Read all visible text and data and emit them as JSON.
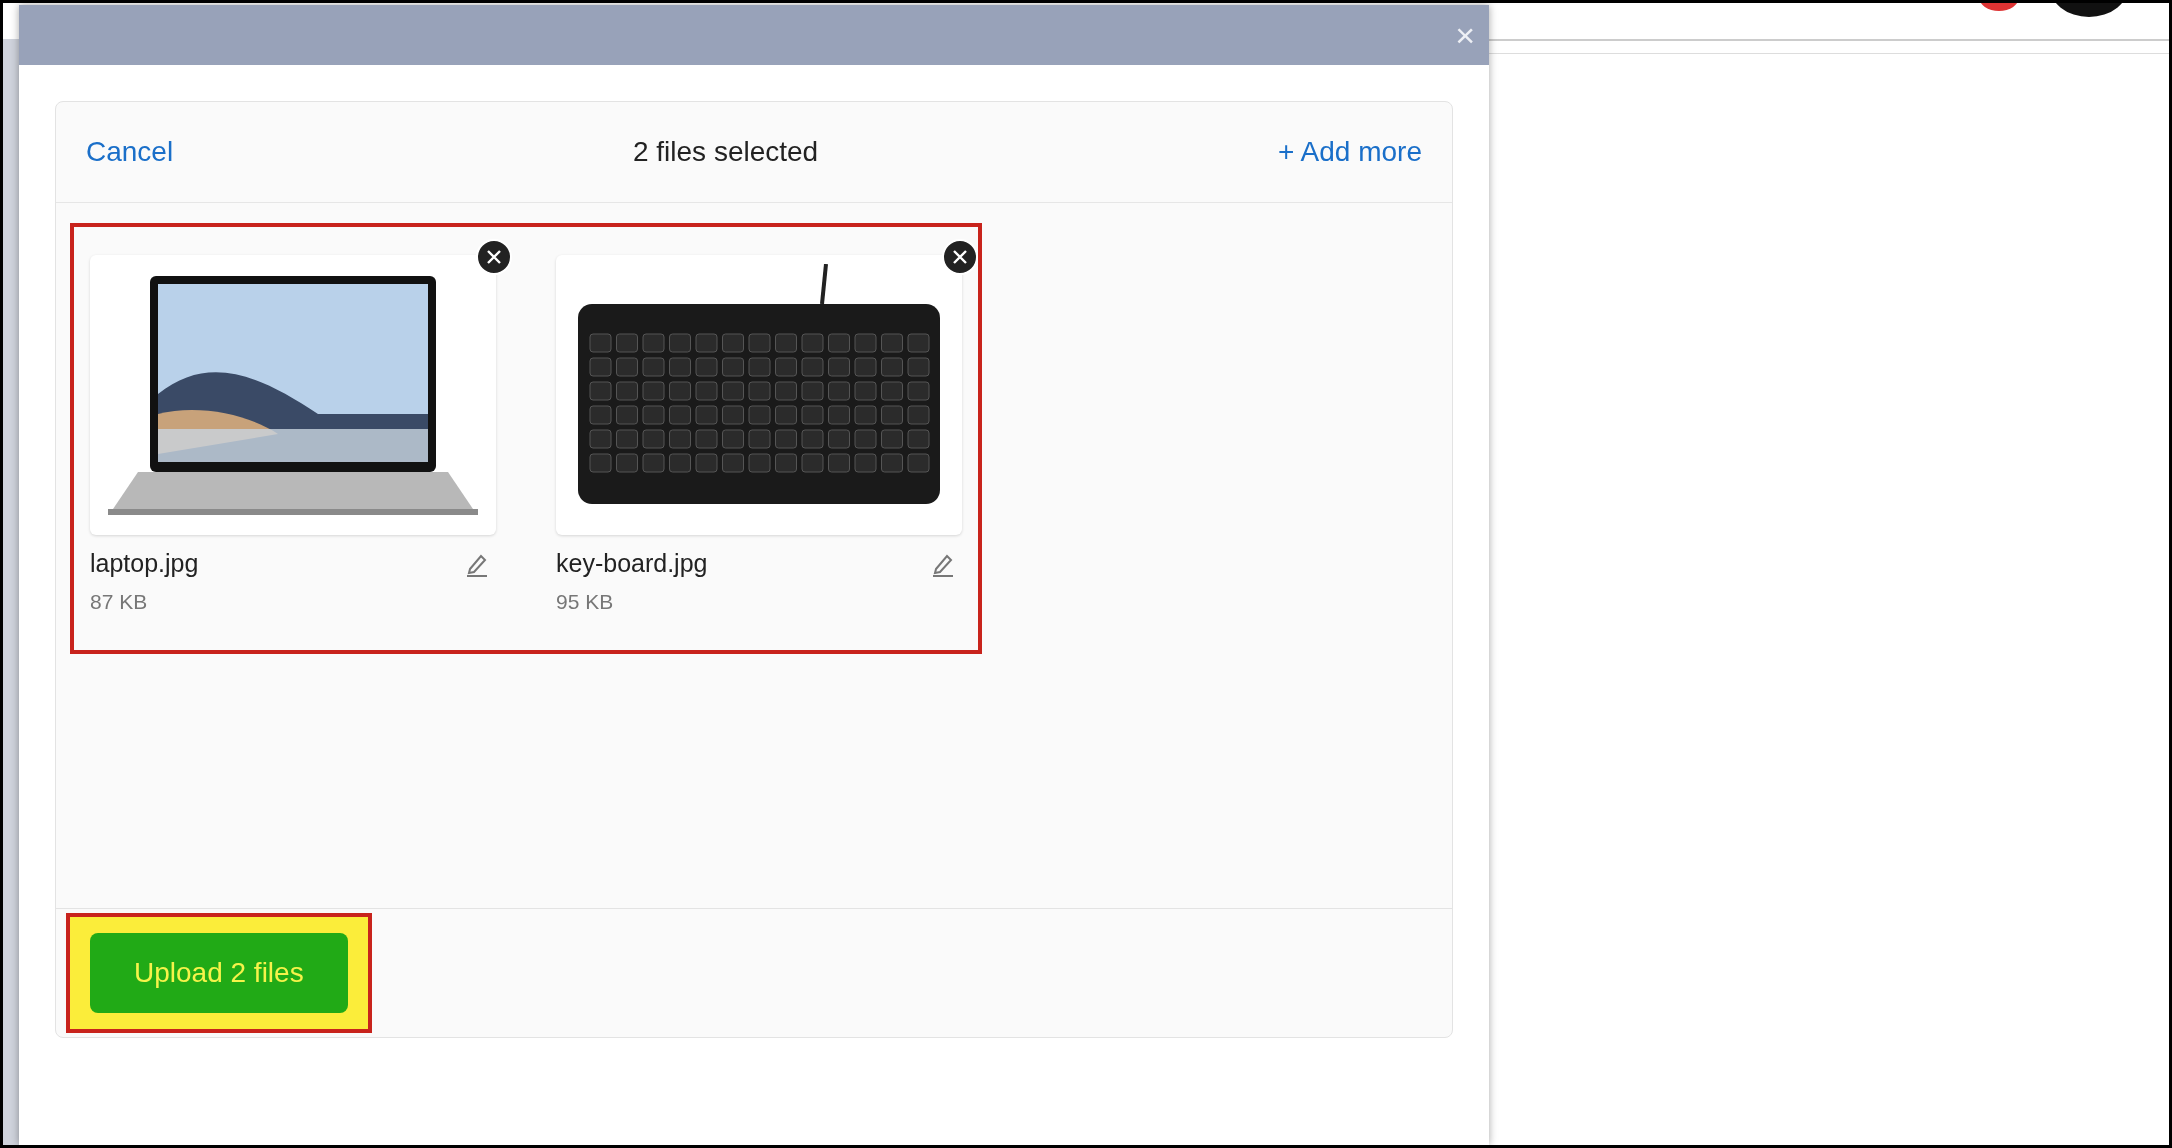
{
  "dialog": {
    "close_label": "×"
  },
  "panel": {
    "cancel": "Cancel",
    "title": "2 files selected",
    "add_more": {
      "icon": "+",
      "label": "Add more"
    }
  },
  "files_section": {
    "highlighted": true
  },
  "files": [
    {
      "name": "laptop.jpg",
      "size": "87 KB",
      "kind": "laptop"
    },
    {
      "name": "key-board.jpg",
      "size": "95 KB",
      "kind": "keyboard"
    }
  ],
  "upload_button": {
    "label": "Upload 2 files",
    "highlighted": true
  }
}
